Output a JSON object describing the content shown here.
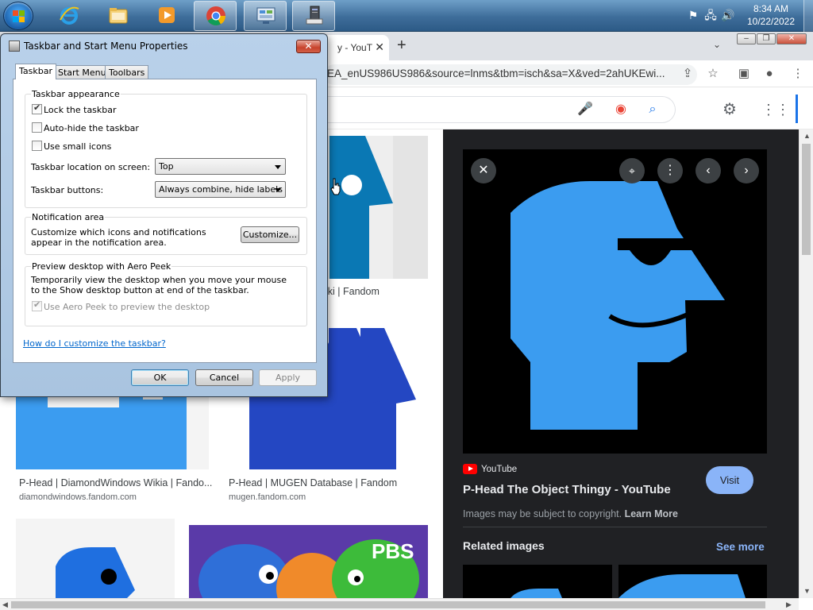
{
  "taskbar": {
    "clock_time": "8:34 AM",
    "clock_date": "10/22/2022",
    "pinned": [
      "start-orb",
      "internet-explorer-icon",
      "file-explorer-icon",
      "media-player-icon",
      "chrome-icon",
      "control-panel-icon",
      "system-properties-icon"
    ]
  },
  "chrome": {
    "tab_title": "y - YouT",
    "url": "EA_enUS986US986&source=lnms&tbm=isch&sa=X&ved=2ahUKEwi..."
  },
  "results": [
    {
      "title": "P-Head | DiamondWindows Wikia | Fando...",
      "source": "diamondwindows.fandom.com"
    },
    {
      "title": "P-Head | MUGEN Database | Fandom",
      "source": "mugen.fandom.com"
    },
    {
      "title": "iki | Fandom",
      "source": ""
    }
  ],
  "panel": {
    "source": "YouTube",
    "title": "P-Head The Object Thingy - YouTube",
    "visit_label": "Visit",
    "copyright": "Images may be subject to copyright.",
    "learn_more": "Learn More",
    "related_label": "Related images",
    "see_more": "See more"
  },
  "dialog": {
    "title": "Taskbar and Start Menu Properties",
    "tabs": [
      "Taskbar",
      "Start Menu",
      "Toolbars"
    ],
    "appearance_group": "Taskbar appearance",
    "lock_label": "Lock the taskbar",
    "autohide_label": "Auto-hide the taskbar",
    "small_icons_label": "Use small icons",
    "location_label": "Taskbar location on screen:",
    "location_value": "Top",
    "buttons_label": "Taskbar buttons:",
    "buttons_value": "Always combine, hide labels",
    "notification_group": "Notification area",
    "notification_text": "Customize which icons and notifications appear in the notification area.",
    "customize_button": "Customize...",
    "aero_group": "Preview desktop with Aero Peek",
    "aero_text": "Temporarily view the desktop when you move your mouse to the Show desktop button at end of the taskbar.",
    "aero_checkbox": "Use Aero Peek to preview the desktop",
    "help_link": "How do I customize the taskbar?",
    "ok": "OK",
    "cancel": "Cancel",
    "apply": "Apply"
  },
  "colors": {
    "panel_bg": "#202124",
    "phead_blue": "#3b9cf0",
    "visit_blue": "#8ab4f8"
  }
}
